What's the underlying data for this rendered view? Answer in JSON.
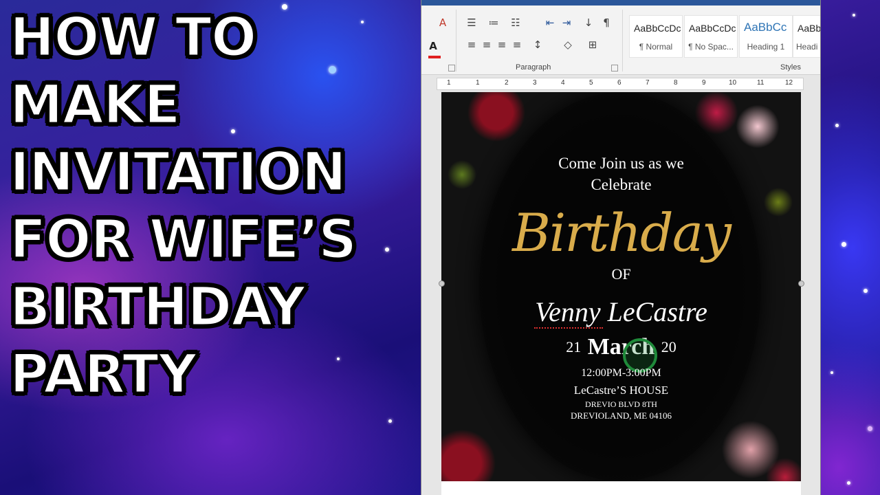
{
  "thumbnail_title": {
    "lines": [
      "HOW TO",
      "MAKE",
      "INVITATION",
      "FOR WIFE’S",
      "BIRTHDAY",
      "PARTY"
    ]
  },
  "word": {
    "ribbon": {
      "paragraph_group_label": "Paragraph",
      "styles_group_label": "Styles",
      "styles": [
        {
          "sample": "AaBbCcDc",
          "name": "¶ Normal"
        },
        {
          "sample": "AaBbCcDc",
          "name": "¶ No Spac..."
        },
        {
          "sample": "AaBbCc",
          "name": "Heading 1"
        },
        {
          "sample": "AaBb",
          "name": "Headi"
        }
      ],
      "icons": {
        "clear_format": "A",
        "font_color": "A",
        "pilcrow": "¶",
        "sort": "↓"
      }
    },
    "ruler": {
      "numbers": [
        "1",
        "1",
        "2",
        "3",
        "4",
        "5",
        "6",
        "7",
        "8",
        "9",
        "10",
        "11",
        "12"
      ]
    },
    "invitation": {
      "line1": "Come Join us as we",
      "line2": "Celebrate",
      "headline": "Birthday",
      "of": "OF",
      "name": "Venny LeCastre",
      "date_day": "21",
      "date_month": "March",
      "date_year": "20",
      "time": "12:00PM-3:00PM",
      "venue": "LeCastre’S HOUSE",
      "street": "DREVIO BLVD 8TH",
      "city": "DREVIOLAND, ME 04106"
    }
  }
}
